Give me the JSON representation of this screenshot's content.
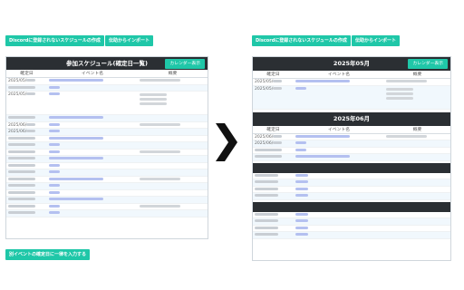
{
  "left": {
    "create_button": "Discordに登録されないスケジュールの作成",
    "import_button": "伝助からインポート",
    "panel_title": "参加スケジュール(確定日一覧)",
    "calendar_button": "カレンダー表示",
    "columns": [
      "確定日",
      "イベント名",
      "概要"
    ],
    "bottom_button": "別イベントの確定日に一律を入力する",
    "rows": [
      {
        "date": "2025/05/",
        "event": "",
        "summary": ""
      },
      {
        "date": "",
        "event": "",
        "summary": ""
      },
      {
        "date": "2025/05/",
        "event": "",
        "summary": ""
      },
      {
        "date": "",
        "event": "",
        "summary": ""
      },
      {
        "date": "2025/06/",
        "event": "",
        "summary": ""
      },
      {
        "date": "2025/06/",
        "event": "",
        "summary": ""
      },
      {
        "date": "",
        "event": "",
        "summary": ""
      },
      {
        "date": "",
        "event": "",
        "summary": ""
      },
      {
        "date": "",
        "event": "",
        "summary": ""
      },
      {
        "date": "",
        "event": "",
        "summary": ""
      },
      {
        "date": "",
        "event": "",
        "summary": ""
      },
      {
        "date": "",
        "event": "",
        "summary": ""
      },
      {
        "date": "",
        "event": "",
        "summary": ""
      },
      {
        "date": "",
        "event": "",
        "summary": ""
      },
      {
        "date": "",
        "event": "",
        "summary": ""
      },
      {
        "date": "",
        "event": "",
        "summary": ""
      },
      {
        "date": "",
        "event": "",
        "summary": ""
      },
      {
        "date": "",
        "event": "",
        "summary": ""
      }
    ]
  },
  "right": {
    "create_button": "Discordに登録されないスケジュールの作成",
    "import_button": "伝助からインポート",
    "calendar_button": "カレンダー表示",
    "columns": [
      "確定日",
      "イベント名",
      "概要"
    ],
    "month1_title": "2025年05月",
    "month1_rows": [
      {
        "date": "2025/05/",
        "event": "",
        "summary": ""
      },
      {
        "date": "2025/05/",
        "event": "",
        "summary": ""
      }
    ],
    "month2_title": "2025年06月",
    "month2_rows": [
      {
        "date": "2025/06/",
        "event": "",
        "summary": ""
      },
      {
        "date": "2025/06/",
        "event": "",
        "summary": ""
      },
      {
        "date": "",
        "event": "",
        "summary": ""
      },
      {
        "date": "",
        "event": "",
        "summary": ""
      }
    ]
  },
  "arrow_icon": "chevron-right-icon",
  "accent_color": "#1fc7a8",
  "header_color": "#2b2f33"
}
